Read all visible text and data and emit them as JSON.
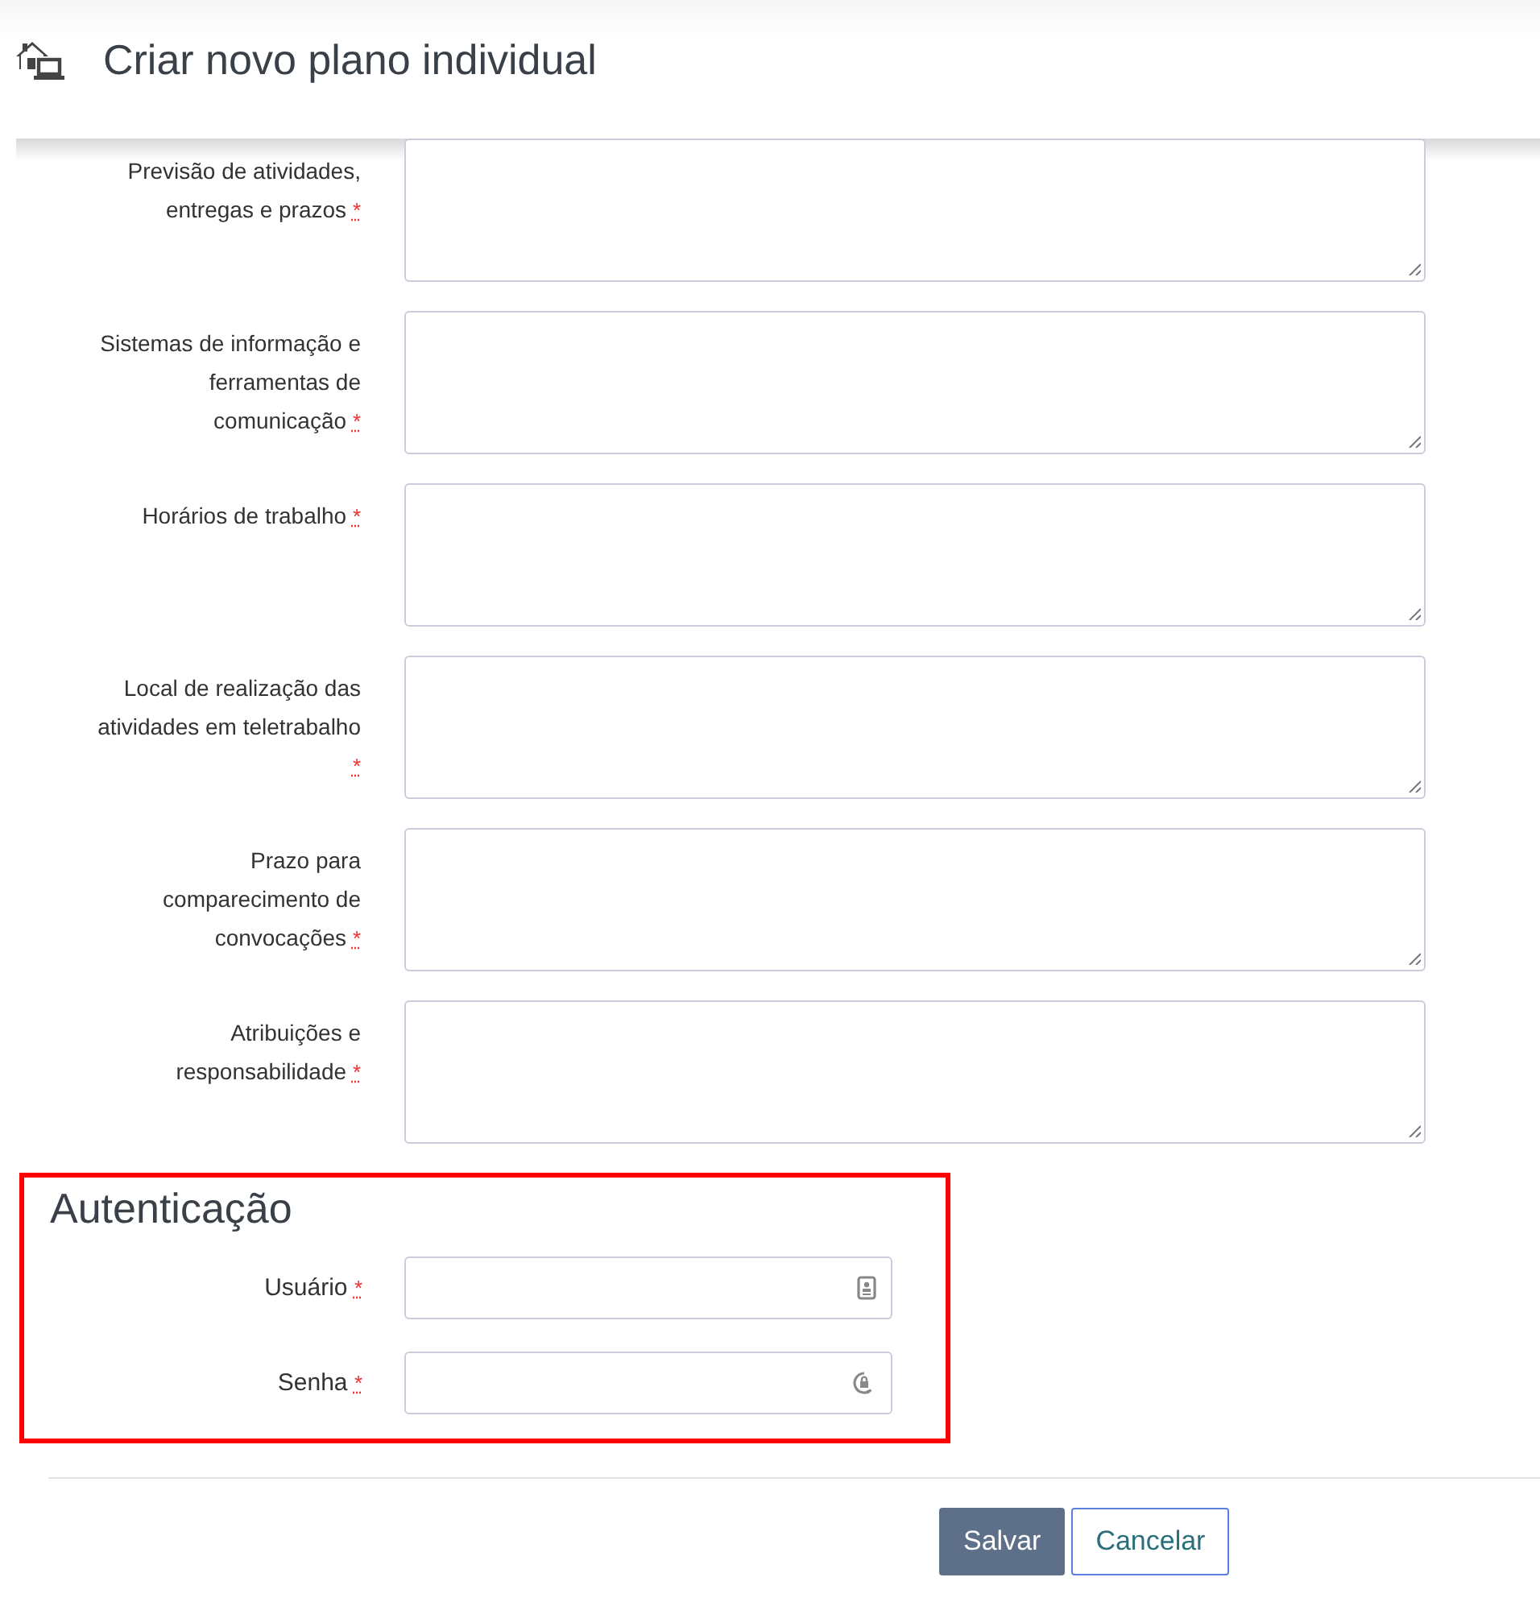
{
  "header": {
    "title": "Criar novo plano individual"
  },
  "fields": [
    {
      "label_lines": [
        "Previsão de atividades,",
        "entregas e prazos"
      ],
      "required_mark": "*",
      "mark_wrapped": false
    },
    {
      "label_lines": [
        "Sistemas de informação e",
        "ferramentas de",
        "comunicação"
      ],
      "required_mark": "*",
      "mark_wrapped": false
    },
    {
      "label_lines": [
        "Horários de trabalho"
      ],
      "required_mark": "*",
      "mark_wrapped": false
    },
    {
      "label_lines": [
        "Local de realização das",
        "atividades em teletrabalho"
      ],
      "required_mark": "*",
      "mark_wrapped": true
    },
    {
      "label_lines": [
        "Prazo para",
        "comparecimento de",
        "convocações"
      ],
      "required_mark": "*",
      "mark_wrapped": false
    },
    {
      "label_lines": [
        "Atribuições e",
        "responsabilidade"
      ],
      "required_mark": "*",
      "mark_wrapped": false
    }
  ],
  "authentication": {
    "heading": "Autenticação",
    "highlighted": true,
    "fields": [
      {
        "kind": "user",
        "label": "Usuário",
        "required_mark": "*"
      },
      {
        "kind": "password",
        "label": "Senha",
        "required_mark": "*"
      }
    ]
  },
  "buttons": [
    {
      "kind": "primary",
      "label": "Salvar"
    },
    {
      "kind": "secondary",
      "label": "Cancelar"
    }
  ]
}
